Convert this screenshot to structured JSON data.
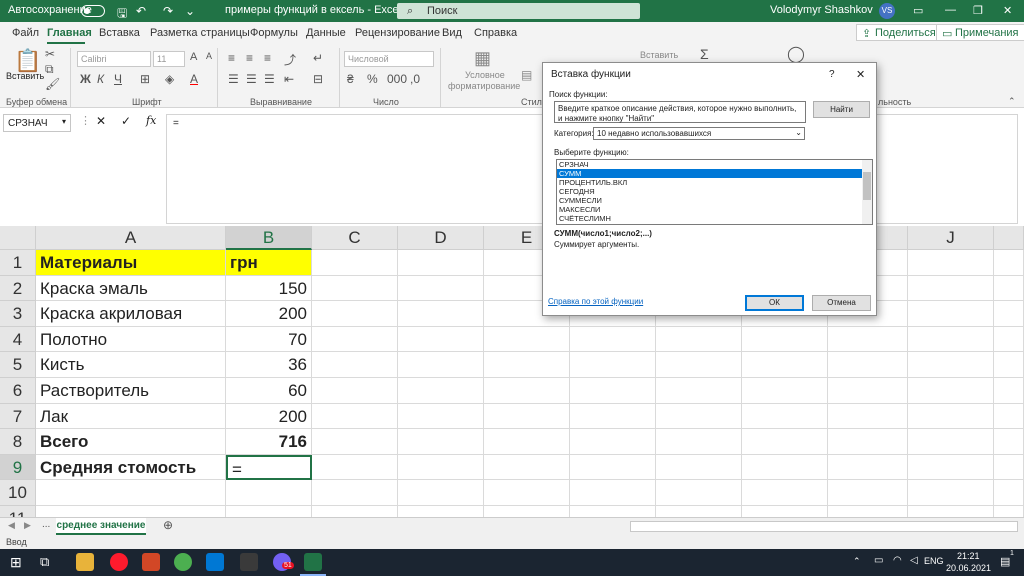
{
  "titlebar": {
    "autosave_label": "Автосохранение",
    "document_title": "примеры функций в ексель  -  Excel",
    "search_placeholder": "Поиск",
    "user_name": "Volodymyr Shashkov",
    "user_initials": "VS"
  },
  "tabs": [
    "Файл",
    "Главная",
    "Вставка",
    "Разметка страницы",
    "Формулы",
    "Данные",
    "Рецензирование",
    "Вид",
    "Справка"
  ],
  "ribbon_buttons": {
    "share": "Поделиться",
    "comments": "Примечания"
  },
  "ribbon": {
    "paste_label": "Вставить",
    "font_name": "Calibri",
    "font_size": "11",
    "number_format": "Числовой",
    "cond_format": "Условное форматирование",
    "cond_format_line1": "Условное",
    "cond_format_line2": "форматирование",
    "insert_label": "Вставить",
    "groups": {
      "clipboard": "Буфер обмена",
      "font": "Шрифт",
      "alignment": "Выравнивание",
      "number": "Число",
      "styles": "Стили",
      "editing": "льность"
    }
  },
  "formula_bar": {
    "name_box": "СРЗНАЧ",
    "formula": "=",
    "fx": "fx"
  },
  "columns": [
    "A",
    "B",
    "C",
    "D",
    "E",
    "F",
    "G",
    "H",
    "I",
    "J"
  ],
  "rows": [
    {
      "num": "1",
      "a": "Материалы",
      "b": "грн"
    },
    {
      "num": "2",
      "a": "Краска эмаль",
      "b": "150"
    },
    {
      "num": "3",
      "a": "Краска акриловая",
      "b": "200"
    },
    {
      "num": "4",
      "a": "Полотно",
      "b": "70"
    },
    {
      "num": "5",
      "a": "Кисть",
      "b": "36"
    },
    {
      "num": "6",
      "a": "Растворитель",
      "b": "60"
    },
    {
      "num": "7",
      "a": "Лак",
      "b": "200"
    },
    {
      "num": "8",
      "a": "Всего",
      "b": "716"
    },
    {
      "num": "9",
      "a": "Средняя стомость",
      "b": "="
    },
    {
      "num": "10",
      "a": "",
      "b": ""
    },
    {
      "num": "11",
      "a": "",
      "b": ""
    }
  ],
  "sheet": {
    "tab_name": "среднее значение",
    "ellipsis": "...",
    "status": "Ввод"
  },
  "dialog": {
    "title": "Вставка функции",
    "help": "?",
    "close": "✕",
    "search_label": "Поиск функции:",
    "search_text": "Введите краткое описание действия, которое нужно выполнить, и нажмите кнопку \"Найти\"",
    "find_button": "Найти",
    "category_label": "Категория:",
    "category_value": "10 недавно использовавшихся",
    "select_label": "Выберите функцию:",
    "functions": [
      "СРЗНАЧ",
      "СУММ",
      "ПРОЦЕНТИЛЬ.ВКЛ",
      "СЕГОДНЯ",
      "СУММЕСЛИ",
      "МАКСЕСЛИ",
      "СЧЁТЕСЛИМН"
    ],
    "selected_index": 1,
    "signature": "СУММ(число1;число2;...)",
    "description": "Суммирует аргументы.",
    "help_link": "Справка по этой функции",
    "ok": "ОК",
    "cancel": "Отмена"
  },
  "taskbar": {
    "time": "21:21",
    "date": "20.06.2021",
    "lang": "ENG",
    "badge": "51",
    "notif": "1"
  },
  "colors": {
    "excel_green": "#217346",
    "highlight_yellow": "#ffff00",
    "selection_blue": "#0078d7"
  }
}
